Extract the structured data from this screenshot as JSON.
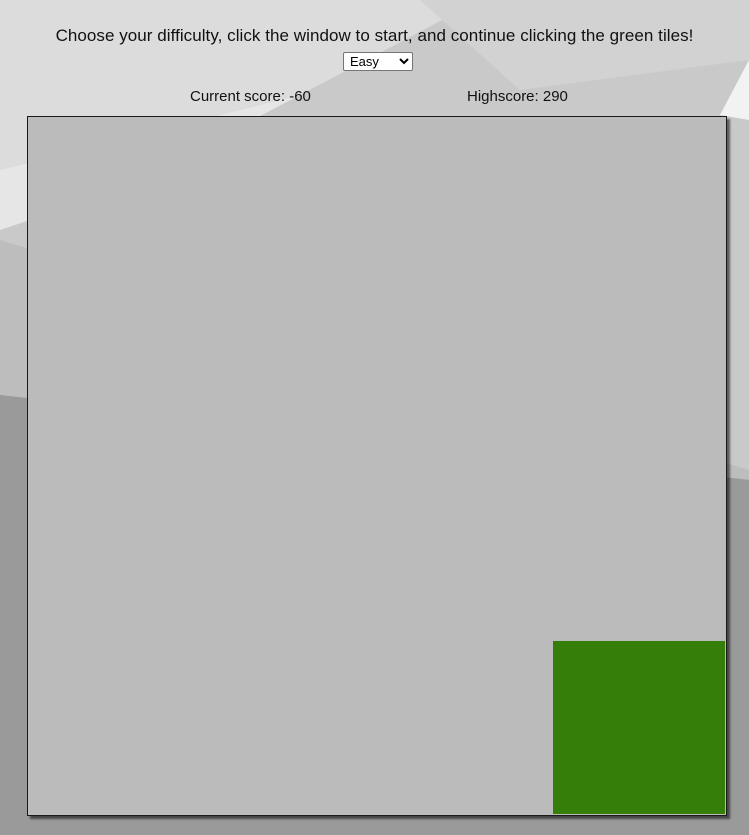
{
  "instructions": "Choose your difficulty, click the window to start, and continue clicking the green tiles!",
  "difficulty": {
    "selected": "Easy",
    "options": [
      "Easy"
    ]
  },
  "scores": {
    "current_label": "Current score: -60",
    "high_label": "Highscore: 290"
  },
  "colors": {
    "game_window": "#bbbbbb",
    "tile": "#367e0a"
  }
}
